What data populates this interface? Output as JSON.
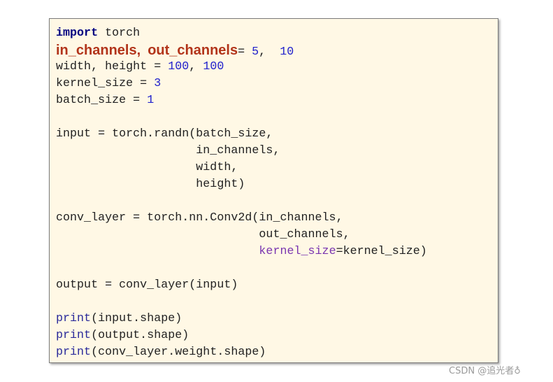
{
  "code_lines": [
    [
      {
        "t": "import",
        "c": "kw"
      },
      {
        "t": " torch",
        "c": ""
      }
    ],
    [
      {
        "t": "in_channels",
        "c": "hl"
      },
      {
        "t": ",",
        "c": "hl"
      },
      {
        "t": " ",
        "c": ""
      },
      {
        "t": "out_channels",
        "c": "hl"
      },
      {
        "t": "= ",
        "c": ""
      },
      {
        "t": "5",
        "c": "num"
      },
      {
        "t": ",  ",
        "c": ""
      },
      {
        "t": "10",
        "c": "num"
      }
    ],
    [
      {
        "t": "width, height = ",
        "c": ""
      },
      {
        "t": "100",
        "c": "num"
      },
      {
        "t": ", ",
        "c": ""
      },
      {
        "t": "100",
        "c": "num"
      }
    ],
    [
      {
        "t": "kernel_size = ",
        "c": ""
      },
      {
        "t": "3",
        "c": "num"
      }
    ],
    [
      {
        "t": "batch_size = ",
        "c": ""
      },
      {
        "t": "1",
        "c": "num"
      }
    ],
    [],
    [
      {
        "t": "input = torch.randn(batch_size,",
        "c": ""
      }
    ],
    [
      {
        "t": "                    in_channels,",
        "c": ""
      }
    ],
    [
      {
        "t": "                    width,",
        "c": ""
      }
    ],
    [
      {
        "t": "                    height)",
        "c": ""
      }
    ],
    [],
    [
      {
        "t": "conv_layer = torch.nn.Conv2d(in_channels,",
        "c": ""
      }
    ],
    [
      {
        "t": "                             out_channels,",
        "c": ""
      }
    ],
    [
      {
        "t": "                             ",
        "c": ""
      },
      {
        "t": "kernel_size",
        "c": "kwarg"
      },
      {
        "t": "=kernel_size)",
        "c": ""
      }
    ],
    [],
    [
      {
        "t": "output = conv_layer(input)",
        "c": ""
      }
    ],
    [],
    [
      {
        "t": "print",
        "c": "fn"
      },
      {
        "t": "(input.shape)",
        "c": ""
      }
    ],
    [
      {
        "t": "print",
        "c": "fn"
      },
      {
        "t": "(output.shape)",
        "c": ""
      }
    ],
    [
      {
        "t": "print",
        "c": "fn"
      },
      {
        "t": "(conv_layer.weight.shape)",
        "c": ""
      }
    ]
  ],
  "watermark": "CSDN @追光者♁"
}
